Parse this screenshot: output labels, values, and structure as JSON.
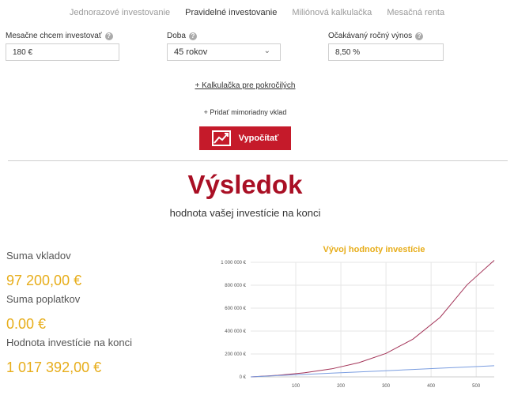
{
  "tabs": [
    {
      "label": "Jednorazové investovanie",
      "active": false
    },
    {
      "label": "Pravidelné investovanie",
      "active": true
    },
    {
      "label": "Miliónová kalkulačka",
      "active": false
    },
    {
      "label": "Mesačná renta",
      "active": false
    }
  ],
  "form": {
    "monthly": {
      "label": "Mesačne chcem investovať",
      "value": "180 €"
    },
    "period": {
      "label": "Doba",
      "value": "45 rokov"
    },
    "return": {
      "label": "Očakávaný ročný výnos",
      "value": "8,50 %"
    }
  },
  "advanced_link": "+ Kalkulačka pre pokročilých",
  "extra_deposit": "+ Pridať mimoriadny vklad",
  "calc_button": "Vypočítať",
  "result": {
    "title": "Výsledok",
    "subtitle": "hodnota vašej investície na konci",
    "deposits_label": "Suma vkladov",
    "deposits_value": "97 200,00 €",
    "fees_label": "Suma poplatkov",
    "fees_value": "0.00 €",
    "final_label": "Hodnota investície na konci",
    "final_value": "1 017 392,00 €"
  },
  "colors": {
    "accent": "#c51a2a",
    "title": "#a90f24",
    "gold": "#e7ad1a",
    "series_value": "#a33458",
    "series_deposits": "#7a9de0"
  },
  "chart_data": {
    "type": "line",
    "title": "Vývoj hodnoty investície",
    "xlabel": "",
    "ylabel": "",
    "xlim": [
      0,
      540
    ],
    "ylim": [
      0,
      1000000
    ],
    "x_ticks": [
      "100",
      "200",
      "300",
      "400",
      "500"
    ],
    "x_tick_values": [
      100,
      200,
      300,
      400,
      500
    ],
    "y_ticks": [
      "0 €",
      "200 000 €",
      "400 000 €",
      "600 000 €",
      "800 000 €",
      "1 000 000 €"
    ],
    "y_tick_values": [
      0,
      200000,
      400000,
      600000,
      800000,
      1000000
    ],
    "grid": true,
    "series": [
      {
        "name": "",
        "color": "#a33458",
        "x": [
          0,
          60,
          120,
          180,
          240,
          300,
          360,
          420,
          480,
          540
        ],
        "y": [
          0,
          13800,
          36000,
          70500,
          124000,
          205000,
          330000,
          520000,
          805000,
          1017392
        ]
      },
      {
        "name": "",
        "color": "#7a9de0",
        "x": [
          0,
          60,
          120,
          180,
          240,
          300,
          360,
          420,
          480,
          540
        ],
        "y": [
          0,
          10800,
          21600,
          32400,
          43200,
          54000,
          64800,
          75600,
          86400,
          97200
        ]
      }
    ]
  }
}
